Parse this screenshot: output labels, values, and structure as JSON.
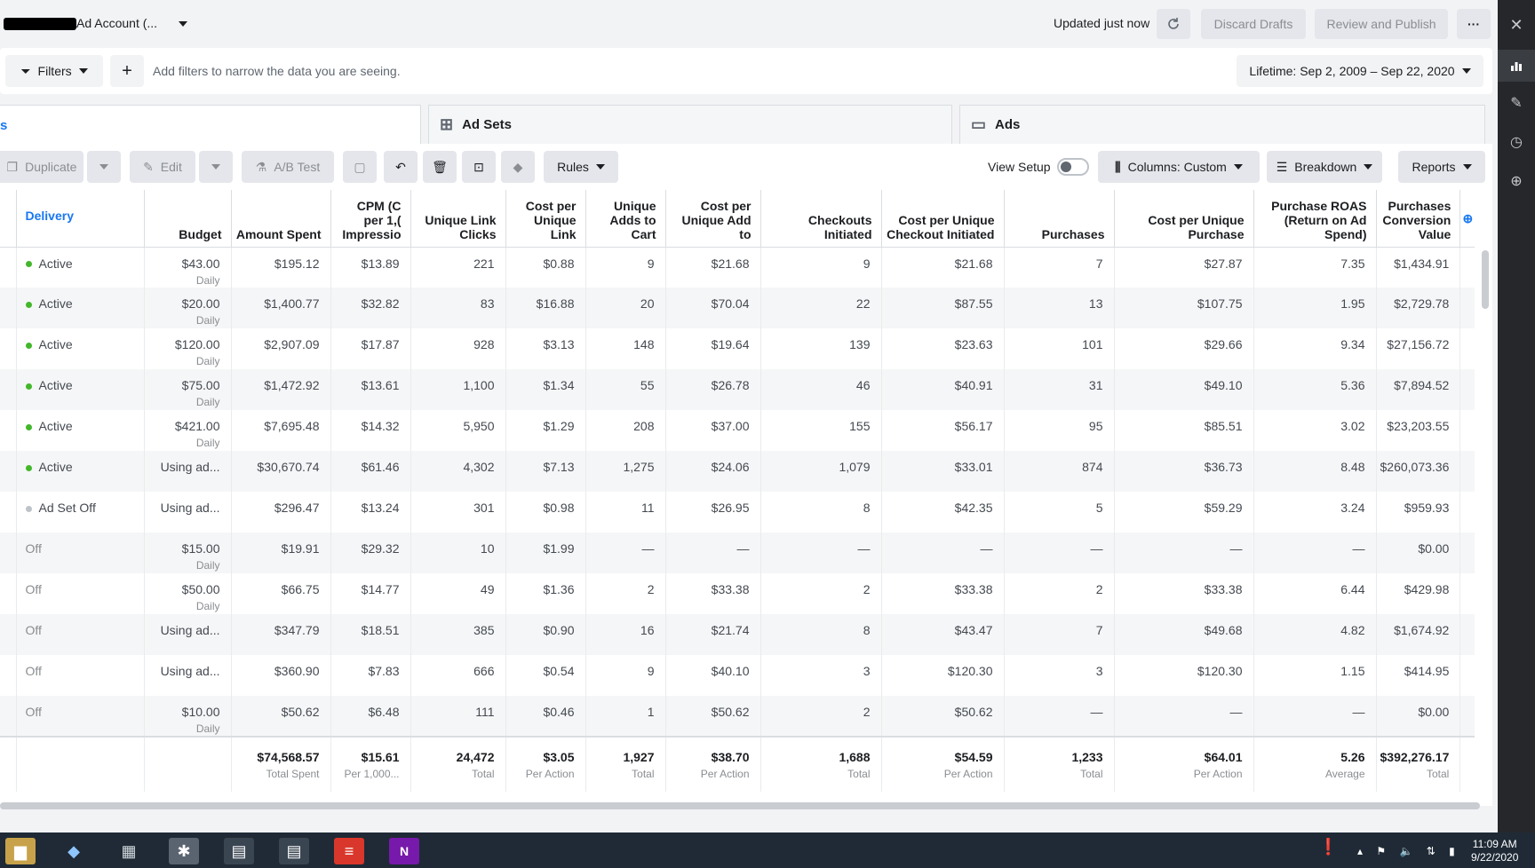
{
  "header": {
    "account_label": "Ad Account (...",
    "updated_text": "Updated just now",
    "discard_label": "Discard Drafts",
    "review_label": "Review and Publish",
    "more_label": "···"
  },
  "filters": {
    "filters_label": "Filters",
    "add_label": "+",
    "placeholder": "Add filters to narrow the data you are seeing.",
    "date_range": "Lifetime: Sep 2, 2009 – Sep 22, 2020"
  },
  "tabs": {
    "campaigns_partial": "s",
    "ad_sets": "Ad Sets",
    "ads": "Ads"
  },
  "toolbar": {
    "duplicate": "Duplicate",
    "edit": "Edit",
    "ab_test": "A/B Test",
    "rules": "Rules",
    "view_setup": "View Setup",
    "columns": "Columns: Custom",
    "breakdown": "Breakdown",
    "reports": "Reports"
  },
  "table": {
    "headers": [
      "Delivery",
      "Budget",
      "Amount Spent",
      "CPM (C per 1,( Impressio",
      "Unique Link Clicks",
      "Cost per Unique Link",
      "Unique Adds to Cart",
      "Cost per Unique Add to",
      "Checkouts Initiated",
      "Cost per Unique Checkout Initiated",
      "Purchases",
      "Cost per Unique Purchase",
      "Purchase ROAS (Return on Ad Spend)",
      "Purchases Conversion Value"
    ],
    "rows": [
      {
        "status": "Active",
        "on": true,
        "budget": "$43.00",
        "budget_sub": "Daily",
        "cells": [
          "$195.12",
          "$13.89",
          "221",
          "$0.88",
          "9",
          "$21.68",
          "9",
          "$21.68",
          "7",
          "$27.87",
          "7.35",
          "$1,434.91"
        ]
      },
      {
        "status": "Active",
        "on": true,
        "budget": "$20.00",
        "budget_sub": "Daily",
        "cells": [
          "$1,400.77",
          "$32.82",
          "83",
          "$16.88",
          "20",
          "$70.04",
          "22",
          "$87.55",
          "13",
          "$107.75",
          "1.95",
          "$2,729.78"
        ]
      },
      {
        "status": "Active",
        "on": true,
        "budget": "$120.00",
        "budget_sub": "Daily",
        "cells": [
          "$2,907.09",
          "$17.87",
          "928",
          "$3.13",
          "148",
          "$19.64",
          "139",
          "$23.63",
          "101",
          "$29.66",
          "9.34",
          "$27,156.72"
        ]
      },
      {
        "status": "Active",
        "on": true,
        "budget": "$75.00",
        "budget_sub": "Daily",
        "cells": [
          "$1,472.92",
          "$13.61",
          "1,100",
          "$1.34",
          "55",
          "$26.78",
          "46",
          "$40.91",
          "31",
          "$49.10",
          "5.36",
          "$7,894.52"
        ]
      },
      {
        "status": "Active",
        "on": true,
        "budget": "$421.00",
        "budget_sub": "Daily",
        "cells": [
          "$7,695.48",
          "$14.32",
          "5,950",
          "$1.29",
          "208",
          "$37.00",
          "155",
          "$56.17",
          "95",
          "$85.51",
          "3.02",
          "$23,203.55"
        ]
      },
      {
        "status": "Active",
        "on": true,
        "budget": "Using ad...",
        "budget_sub": "",
        "cells": [
          "$30,670.74",
          "$61.46",
          "4,302",
          "$7.13",
          "1,275",
          "$24.06",
          "1,079",
          "$33.01",
          "874",
          "$36.73",
          "8.48",
          "$260,073.36"
        ]
      },
      {
        "status": "Ad Set Off",
        "on": false,
        "budget": "Using ad...",
        "budget_sub": "",
        "cells": [
          "$296.47",
          "$13.24",
          "301",
          "$0.98",
          "11",
          "$26.95",
          "8",
          "$42.35",
          "5",
          "$59.29",
          "3.24",
          "$959.93"
        ]
      },
      {
        "status": "Off",
        "on": null,
        "budget": "$15.00",
        "budget_sub": "Daily",
        "cells": [
          "$19.91",
          "$29.32",
          "10",
          "$1.99",
          "—",
          "—",
          "—",
          "—",
          "—",
          "—",
          "—",
          "$0.00"
        ]
      },
      {
        "status": "Off",
        "on": null,
        "budget": "$50.00",
        "budget_sub": "Daily",
        "cells": [
          "$66.75",
          "$14.77",
          "49",
          "$1.36",
          "2",
          "$33.38",
          "2",
          "$33.38",
          "2",
          "$33.38",
          "6.44",
          "$429.98"
        ]
      },
      {
        "status": "Off",
        "on": null,
        "budget": "Using ad...",
        "budget_sub": "",
        "cells": [
          "$347.79",
          "$18.51",
          "385",
          "$0.90",
          "16",
          "$21.74",
          "8",
          "$43.47",
          "7",
          "$49.68",
          "4.82",
          "$1,674.92"
        ]
      },
      {
        "status": "Off",
        "on": null,
        "budget": "Using ad...",
        "budget_sub": "",
        "cells": [
          "$360.90",
          "$7.83",
          "666",
          "$0.54",
          "9",
          "$40.10",
          "3",
          "$120.30",
          "3",
          "$120.30",
          "1.15",
          "$414.95"
        ]
      },
      {
        "status": "Off",
        "on": null,
        "budget": "$10.00",
        "budget_sub": "Daily",
        "cells": [
          "$50.62",
          "$6.48",
          "111",
          "$0.46",
          "1",
          "$50.62",
          "2",
          "$50.62",
          "—",
          "—",
          "—",
          "$0.00"
        ]
      }
    ],
    "totals": [
      {
        "value": "$74,568.57",
        "label": "Total Spent"
      },
      {
        "value": "$15.61",
        "label": "Per 1,000..."
      },
      {
        "value": "24,472",
        "label": "Total"
      },
      {
        "value": "$3.05",
        "label": "Per Action"
      },
      {
        "value": "1,927",
        "label": "Total"
      },
      {
        "value": "$38.70",
        "label": "Per Action"
      },
      {
        "value": "1,688",
        "label": "Total"
      },
      {
        "value": "$54.59",
        "label": "Per Action"
      },
      {
        "value": "1,233",
        "label": "Total"
      },
      {
        "value": "$64.01",
        "label": "Per Action"
      },
      {
        "value": "5.26",
        "label": "Average"
      },
      {
        "value": "$392,276.17",
        "label": "Total"
      }
    ]
  },
  "taskbar": {
    "time": "11:09 AM",
    "date": "9/22/2020"
  },
  "colors": {
    "accent": "#1877f2",
    "active_green": "#42b72a",
    "off_gray": "#bec3c9"
  }
}
